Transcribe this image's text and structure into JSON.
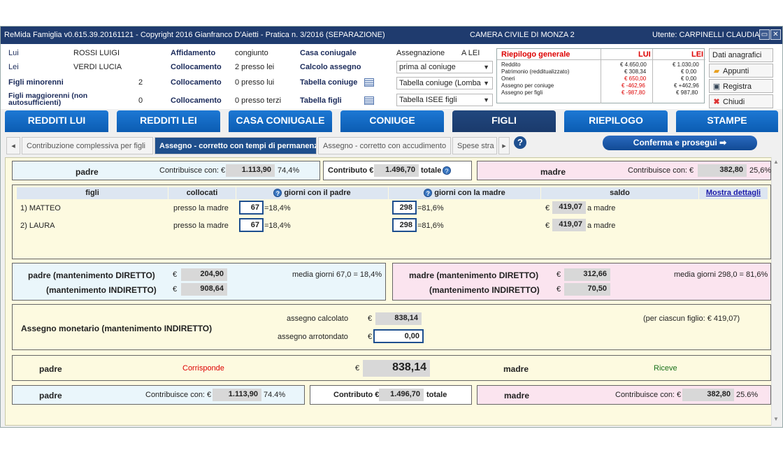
{
  "title_bar": {
    "app": "ReMida Famiglia v0.615.39.20161121 - Copyright 2016 Gianfranco D'Aietti - Pratica n. 3/2016 (SEPARAZIONE)",
    "court": "CAMERA CIVILE DI MONZA 2",
    "user": "Utente: CARPINELLI CLAUDIA"
  },
  "header": {
    "lui_label": "Lui",
    "lui_value": "ROSSI LUIGI",
    "lei_label": "Lei",
    "lei_value": "VERDI LUCIA",
    "minori_label": "Figli minorenni",
    "minori_value": "2",
    "maggiori_label": "Figli maggiorenni (non autosufficienti)",
    "maggiori_value": "0",
    "affidamento_label": "Affidamento",
    "affidamento_value": "congiunto",
    "collocamento_label": "Collocamento",
    "coll1": "2 presso lei",
    "coll2": "0 presso lui",
    "coll3": "0 presso terzi",
    "casa_label": "Casa coniugale",
    "calcolo_label": "Calcolo assegno",
    "tab_coniuge_label": "Tabella coniuge",
    "tab_figli_label": "Tabella figli",
    "assegnazione_label": "Assegnazione",
    "assegnazione_value": "A LEI",
    "sel_calcolo": "prima al coniuge",
    "sel_tab_coniuge": "Tabella coniuge (Lomba",
    "sel_tab_figli": "Tabella ISEE figli"
  },
  "riepilogo": {
    "title": "Riepilogo generale",
    "lui": "LUI",
    "lei": "LEI",
    "rows": [
      {
        "label": "Reddito",
        "lui": "€ 4.650,00",
        "lei": "€ 1.030,00"
      },
      {
        "label": "Patrimonio (redditualizzato)",
        "lui": "€ 308,34",
        "lei": "€ 0,00"
      },
      {
        "label": "Oneri",
        "lui": "€ 650,00",
        "lei": "€ 0,00"
      },
      {
        "label": "Assegno per coniuge",
        "lui": "€ -462,96",
        "lei": "€ +462,96"
      },
      {
        "label": "Assegno per figli",
        "lui": "€ -987,80",
        "lei": "€ 987,80"
      }
    ]
  },
  "side_buttons": {
    "dati": "Dati anagrafici",
    "appunti": "Appunti",
    "registra": "Registra",
    "chiudi": "Chiudi"
  },
  "main_tabs": [
    "REDDITI LUI",
    "REDDITI LEI",
    "CASA CONIUGALE",
    "CONIUGE",
    "FIGLI",
    "RIEPILOGO",
    "STAMPE"
  ],
  "sub_tabs": [
    "Contribuzione complessiva per figli",
    "Assegno - corretto con tempi di permanenza",
    "Assegno - corretto con accudimento",
    "Spese stra"
  ],
  "confirm_label": "Conferma e prosegui",
  "top_summary": {
    "padre": "padre",
    "contrib_lbl": "Contribuisce con: €",
    "padre_val": "1.113,90",
    "padre_pct": "74,4%",
    "contributo_lbl": "Contributo €",
    "contributo_val": "1.496,70",
    "totale": "totale",
    "madre": "madre",
    "madre_val": "382,80",
    "madre_pct": "25,6%"
  },
  "children_table": {
    "headers": [
      "figli",
      "collocati",
      "giorni con il padre",
      "giorni con la madre",
      "saldo"
    ],
    "details_link": "Mostra dettagli",
    "rows": [
      {
        "name": "1) MATTEO",
        "coll": "presso la madre",
        "gp": "67",
        "gp_pct": "=18,4%",
        "gm": "298",
        "gm_pct": "=81,6%",
        "euro": "€",
        "saldo": "419,07",
        "a": "a madre"
      },
      {
        "name": "2) LAURA",
        "coll": "presso la madre",
        "gp": "67",
        "gp_pct": "=18,4%",
        "gm": "298",
        "gm_pct": "=81,6%",
        "euro": "€",
        "saldo": "419,07",
        "a": "a madre"
      }
    ]
  },
  "mantenimento": {
    "padre_diretto": "padre (mantenimento DIRETTO)",
    "padre_indiretto": "(mantenimento INDIRETTO)",
    "euro": "€",
    "padre_diretto_val": "204,90",
    "padre_indiretto_val": "908,64",
    "padre_media": "media giorni 67,0 = 18,4%",
    "madre_diretto": "madre (mantenimento DIRETTO)",
    "madre_indiretto": "(mantenimento INDIRETTO)",
    "madre_diretto_val": "312,66",
    "madre_indiretto_val": "70,50",
    "madre_media": "media giorni 298,0 = 81,6%"
  },
  "assegno": {
    "label": "Assegno monetario (mantenimento INDIRETTO)",
    "calcolato_lbl": "assegno calcolato",
    "calcolato_val": "838,14",
    "arrotondato_lbl": "assegno arrotondato",
    "arrotondato_val": "0,00",
    "euro": "€",
    "per_figlio": "(per ciascun figlio: € 419,07)"
  },
  "corrisponde": {
    "padre": "padre",
    "corrisponde": "Corrisponde",
    "euro": "€",
    "val": "838,14",
    "madre": "madre",
    "riceve": "Riceve"
  },
  "bottom_summary": {
    "padre": "padre",
    "contrib_lbl": "Contribuisce con: €",
    "padre_val": "1.113,90",
    "padre_pct": "74.4%",
    "contributo_lbl": "Contributo €",
    "contributo_val": "1.496,70",
    "totale": "totale",
    "madre": "madre",
    "madre_val": "382,80",
    "madre_pct": "25.6%"
  },
  "colors": {
    "title_bar": "#1f3b6e",
    "tab_blue": "#0b5cb2",
    "tab_active": "#1a3a6c",
    "pink": "#fbe4ef",
    "light_blue": "#eaf6fb",
    "cream": "#fdfae0"
  }
}
